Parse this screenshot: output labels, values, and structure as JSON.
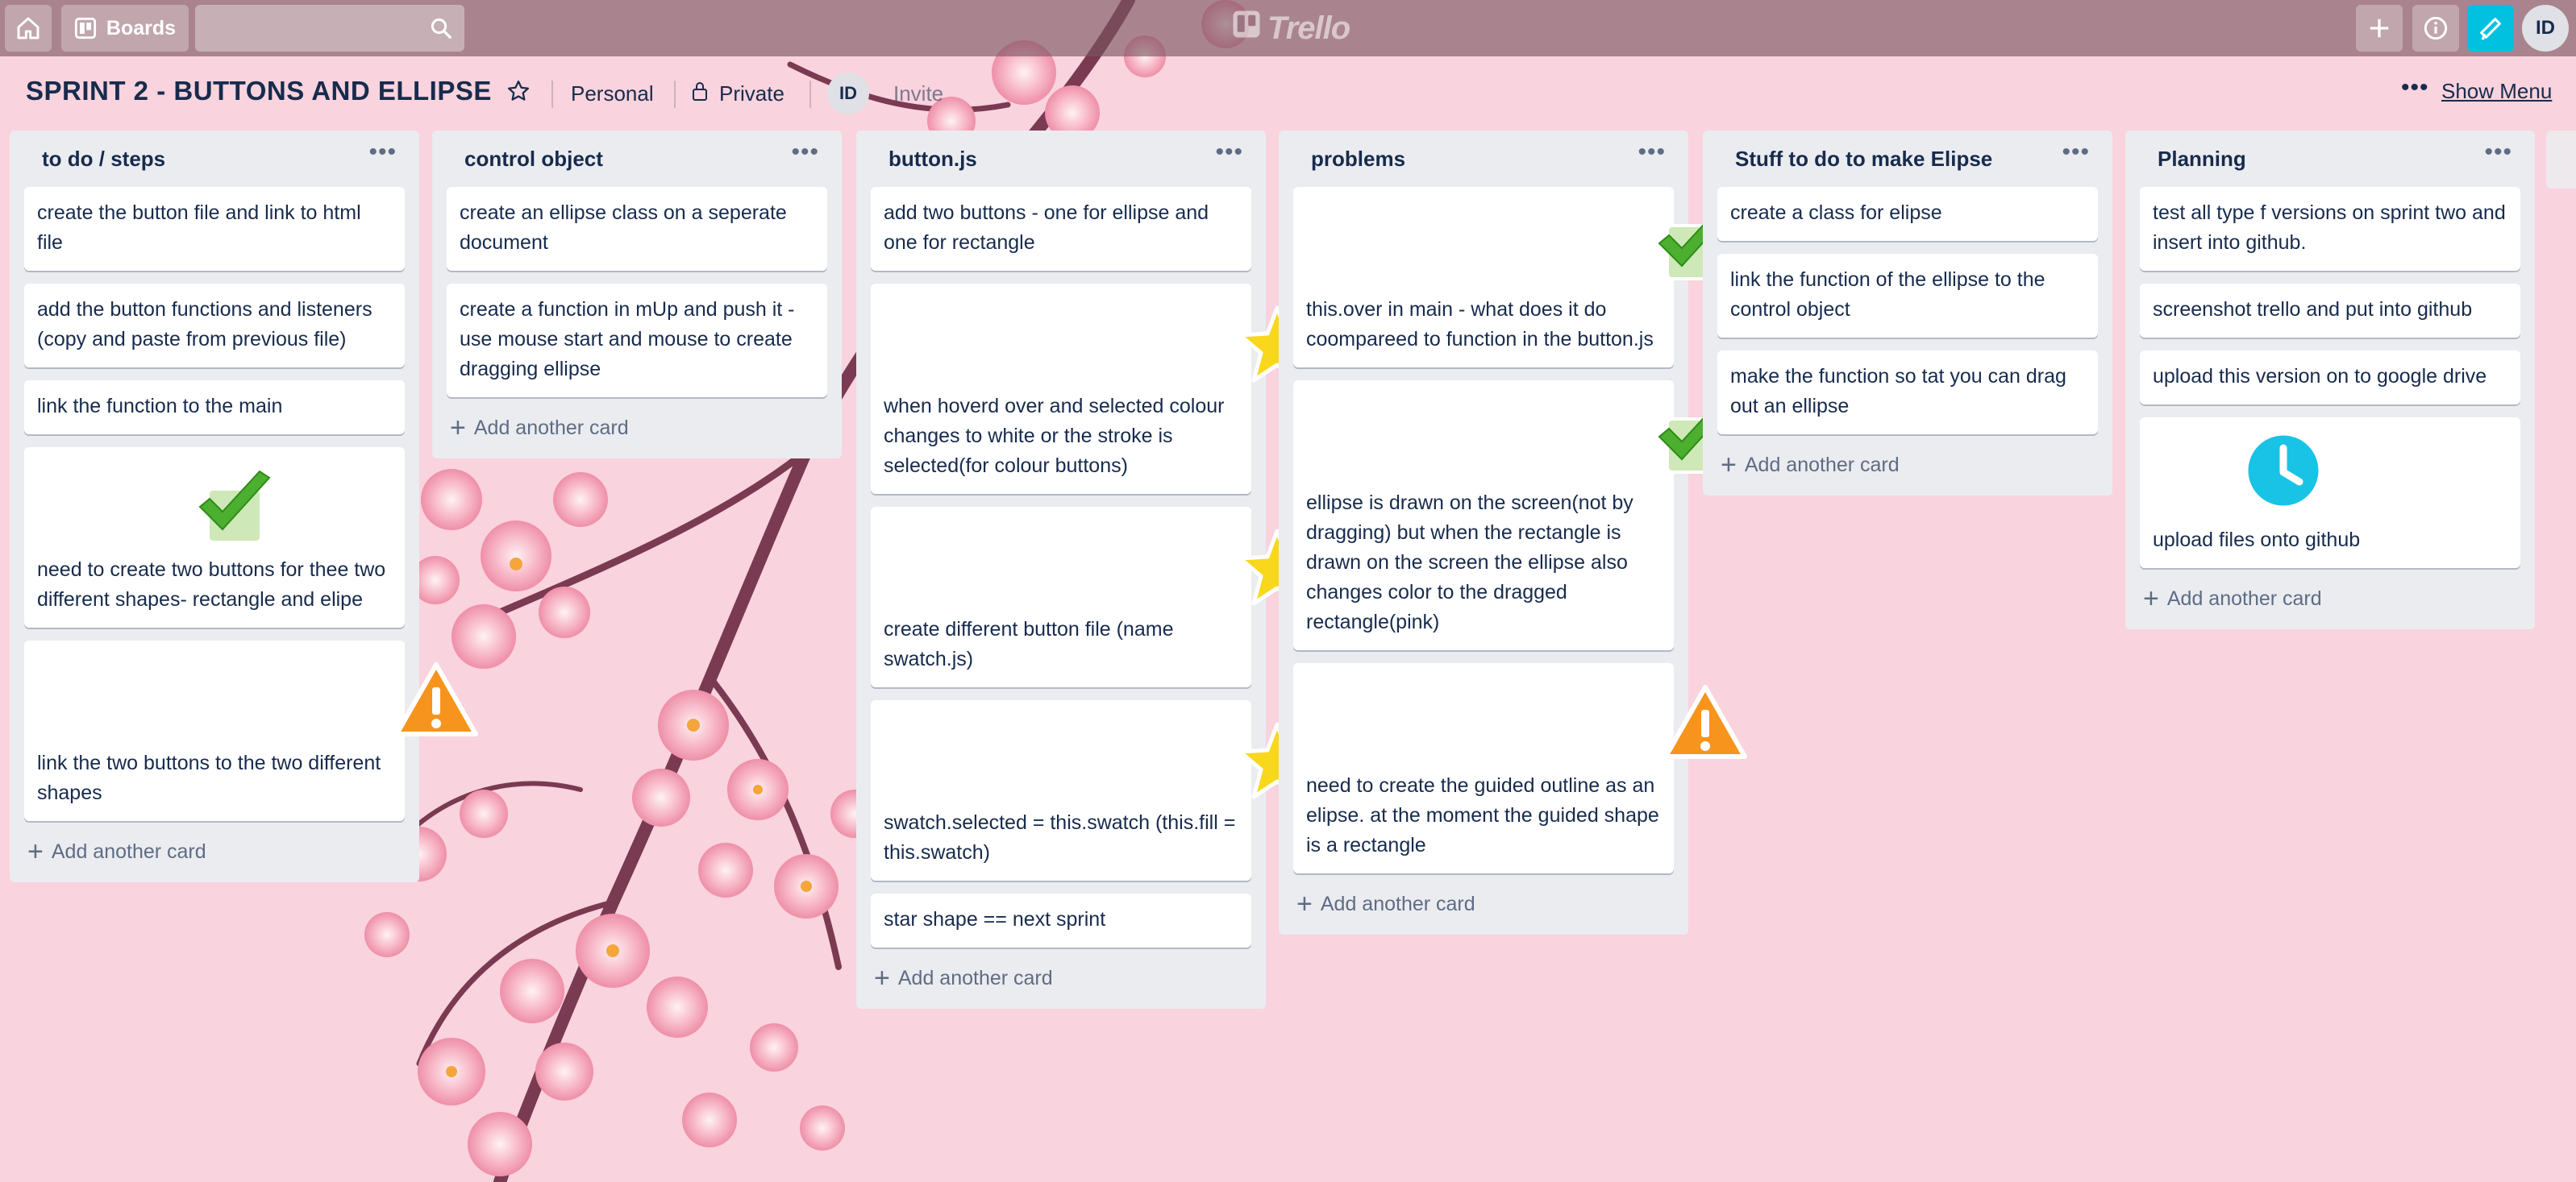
{
  "app": {
    "logo": "Trello"
  },
  "nav": {
    "boards_label": "Boards",
    "search_value": "",
    "user_initials": "ID"
  },
  "board": {
    "title": "SPRINT 2 - BUTTONS AND ELLIPSE",
    "team": "Personal",
    "visibility": "Private",
    "member_initials": "ID",
    "invite_label": "Invite",
    "show_menu_label": "Show Menu"
  },
  "colors": {
    "accent": "#00c2e0",
    "list_bg": "#ebecf0",
    "nav_bg": "#8e6470"
  },
  "lists": [
    {
      "title": "to do / steps",
      "add_label": "Add another card",
      "cards": [
        {
          "text": "create the button file and link to html file"
        },
        {
          "text": "add the button functions and listeners (copy and paste from previous file)"
        },
        {
          "text": "link the function to the main"
        },
        {
          "text": "need to create two buttons for thee two different shapes- rectangle and elipe",
          "sticker": "check-icon"
        },
        {
          "text": "link the two buttons to the two different shapes",
          "sticker": "warning-icon"
        }
      ]
    },
    {
      "title": "control object",
      "add_label": "Add another card",
      "cards": [
        {
          "text": "create an ellipse class on a seperate document"
        },
        {
          "text": "create a function in mUp and push it - use mouse start and mouse to create dragging ellipse"
        }
      ]
    },
    {
      "title": "button.js",
      "add_label": "Add another card",
      "cards": [
        {
          "text": "add two buttons - one for ellipse and one for rectangle"
        },
        {
          "text": "when hoverd over and selected colour changes to white or the stroke is selected(for colour buttons)",
          "sticker": "star-icon"
        },
        {
          "text": "create different button file (name swatch.js)",
          "sticker": "star-icon"
        },
        {
          "text": "swatch.selected = this.swatch (this.fill = this.swatch)",
          "sticker": "star-icon"
        },
        {
          "text": "star shape == next sprint"
        }
      ]
    },
    {
      "title": "problems",
      "add_label": "Add another card",
      "cards": [
        {
          "text": "this.over in main - what does it do coompareed to function in the button.js",
          "sticker": "check-icon"
        },
        {
          "text": "ellipse is drawn on the screen(not by dragging) but when the rectangle is drawn on the screen the ellipse also changes color to the dragged rectangle(pink)",
          "sticker": "check-icon"
        },
        {
          "text": "need to create the guided outline as an elipse. at the moment the guided shape is a rectangle",
          "sticker": "warning-icon"
        }
      ]
    },
    {
      "title": "Stuff to do to make Elipse",
      "add_label": "Add another card",
      "cards": [
        {
          "text": "create a class for elipse"
        },
        {
          "text": "link the function of the ellipse to the control object"
        },
        {
          "text": "make the function so tat you can drag out an ellipse"
        }
      ]
    },
    {
      "title": "Planning",
      "add_label": "Add another card",
      "cards": [
        {
          "text": "test all type f versions on sprint two and insert into github."
        },
        {
          "text": "screenshot trello and put into github"
        },
        {
          "text": "upload this version on to google drive"
        },
        {
          "text": "upload files onto github",
          "sticker": "clock-icon"
        }
      ]
    }
  ]
}
